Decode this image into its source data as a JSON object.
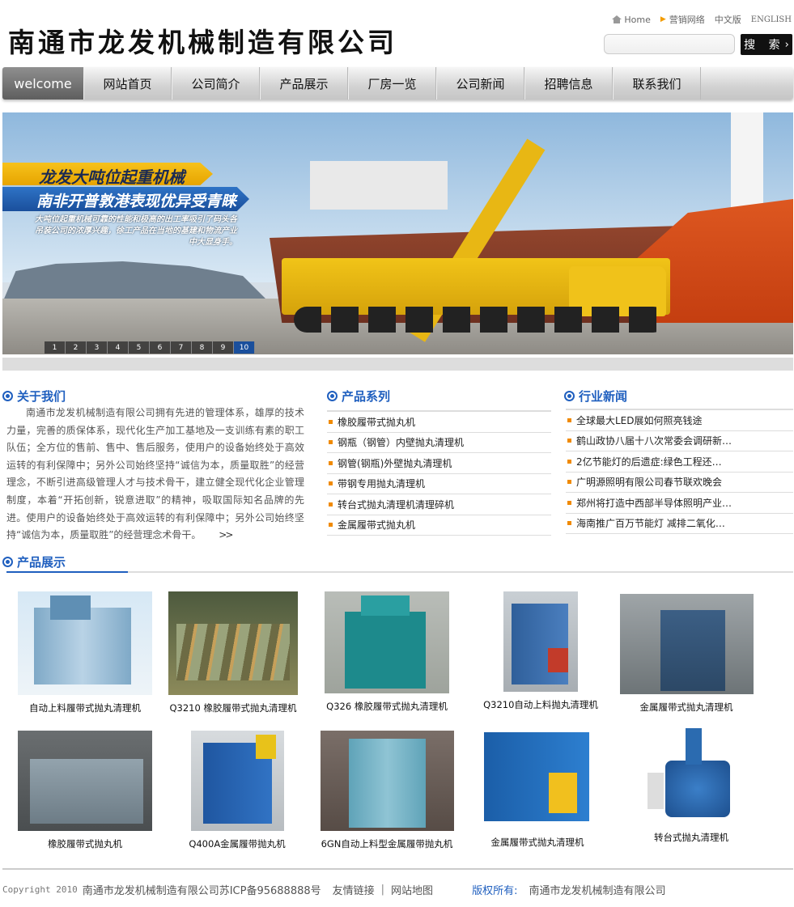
{
  "header": {
    "logo_text": "南通市龙发机械制造有限公司",
    "top_links": {
      "home": "Home",
      "sales": "营销网络",
      "chinese": "中文版",
      "english": "ENGLISH"
    },
    "search": {
      "button": "搜 索",
      "placeholder": ""
    }
  },
  "nav": {
    "welcome": "welcome",
    "items": [
      "网站首页",
      "公司简介",
      "产品展示",
      "厂房一览",
      "公司新闻",
      "招聘信息",
      "联系我们"
    ]
  },
  "banner": {
    "headline": "龙发大吨位起重机械",
    "subheadline": "南非开普敦港表现优异受青睐",
    "caption": "大吨位起重机械可靠的性能和极高的出工率吸引了码头各吊装公司的浓厚兴趣，徐工产品在当地的基建和物流产业中大显身手。",
    "pages": [
      "1",
      "2",
      "3",
      "4",
      "5",
      "6",
      "7",
      "8",
      "9",
      "10"
    ],
    "active_page": "10"
  },
  "about": {
    "title": "关于我们",
    "text": "南通市龙发机械制造有限公司拥有先进的管理体系，雄厚的技术力量，完善的质保体系，现代化生产加工基地及一支训练有素的职工队伍；全方位的售前、售中、售后服务，使用户的设备始终处于高效运转的有利保障中；另外公司始终坚持“诚信为本，质量取胜”的经营理念，不断引进高级管理人才与技术骨干，建立健全现代化企业管理制度，本着“开拓创新，锐意进取”的精神，吸取国际知名品牌的先进。使用户的设备始终处于高效运转的有利保障中；另外公司始终坚持“诚信为本，质量取胜”的经营理念术骨干。",
    "more_icon": "double-chevron-right-icon"
  },
  "series": {
    "title": "产品系列",
    "items": [
      "橡胶履带式抛丸机",
      "钢瓶（钢管）内壁抛丸清理机",
      "钢管(钢瓶)外壁抛丸清理机",
      "带钢专用抛丸清理机",
      "转台式抛丸清理机清理碎机",
      "金属履带式抛丸机"
    ]
  },
  "news": {
    "title": "行业新闻",
    "items": [
      "全球最大LED展如何照亮钱途",
      "鹤山政协八届十八次常委会调研新…",
      "2亿节能灯的后遗症:绿色工程还…",
      "广明源照明有限公司春节联欢晚会",
      "郑州将打造中西部半导体照明产业…",
      "海南推广百万节能灯 减排二氧化…"
    ]
  },
  "products": {
    "title": "产品展示",
    "items": [
      {
        "name": "自动上料履带式抛丸清理机"
      },
      {
        "name": "Q3210 橡胶履带式抛丸清理机"
      },
      {
        "name": "Q326 橡胶履带式抛丸清理机"
      },
      {
        "name": "Q3210自动上料抛丸清理机"
      },
      {
        "name": "金属履带式抛丸清理机"
      },
      {
        "name": "橡胶履带式抛丸机"
      },
      {
        "name": "Q400A金属履带抛丸机"
      },
      {
        "name": "6GN自动上料型金属履带抛丸机"
      },
      {
        "name": "金属履带式抛丸清理机"
      },
      {
        "name": "转台式抛丸清理机"
      }
    ]
  },
  "footer": {
    "copyright": "Copyright 2010",
    "company_icp": "南通市龙发机械制造有限公司苏ICP备95688888号",
    "links": "友情链接",
    "sep": "|",
    "sitemap": "网站地图",
    "owner_label": "版权所有:",
    "owner": "南通市龙发机械制造有限公司"
  },
  "colors": {
    "accent_blue": "#1f5fbf",
    "bullet_orange": "#f08a00",
    "nav_gray": "#d2d2d2"
  }
}
